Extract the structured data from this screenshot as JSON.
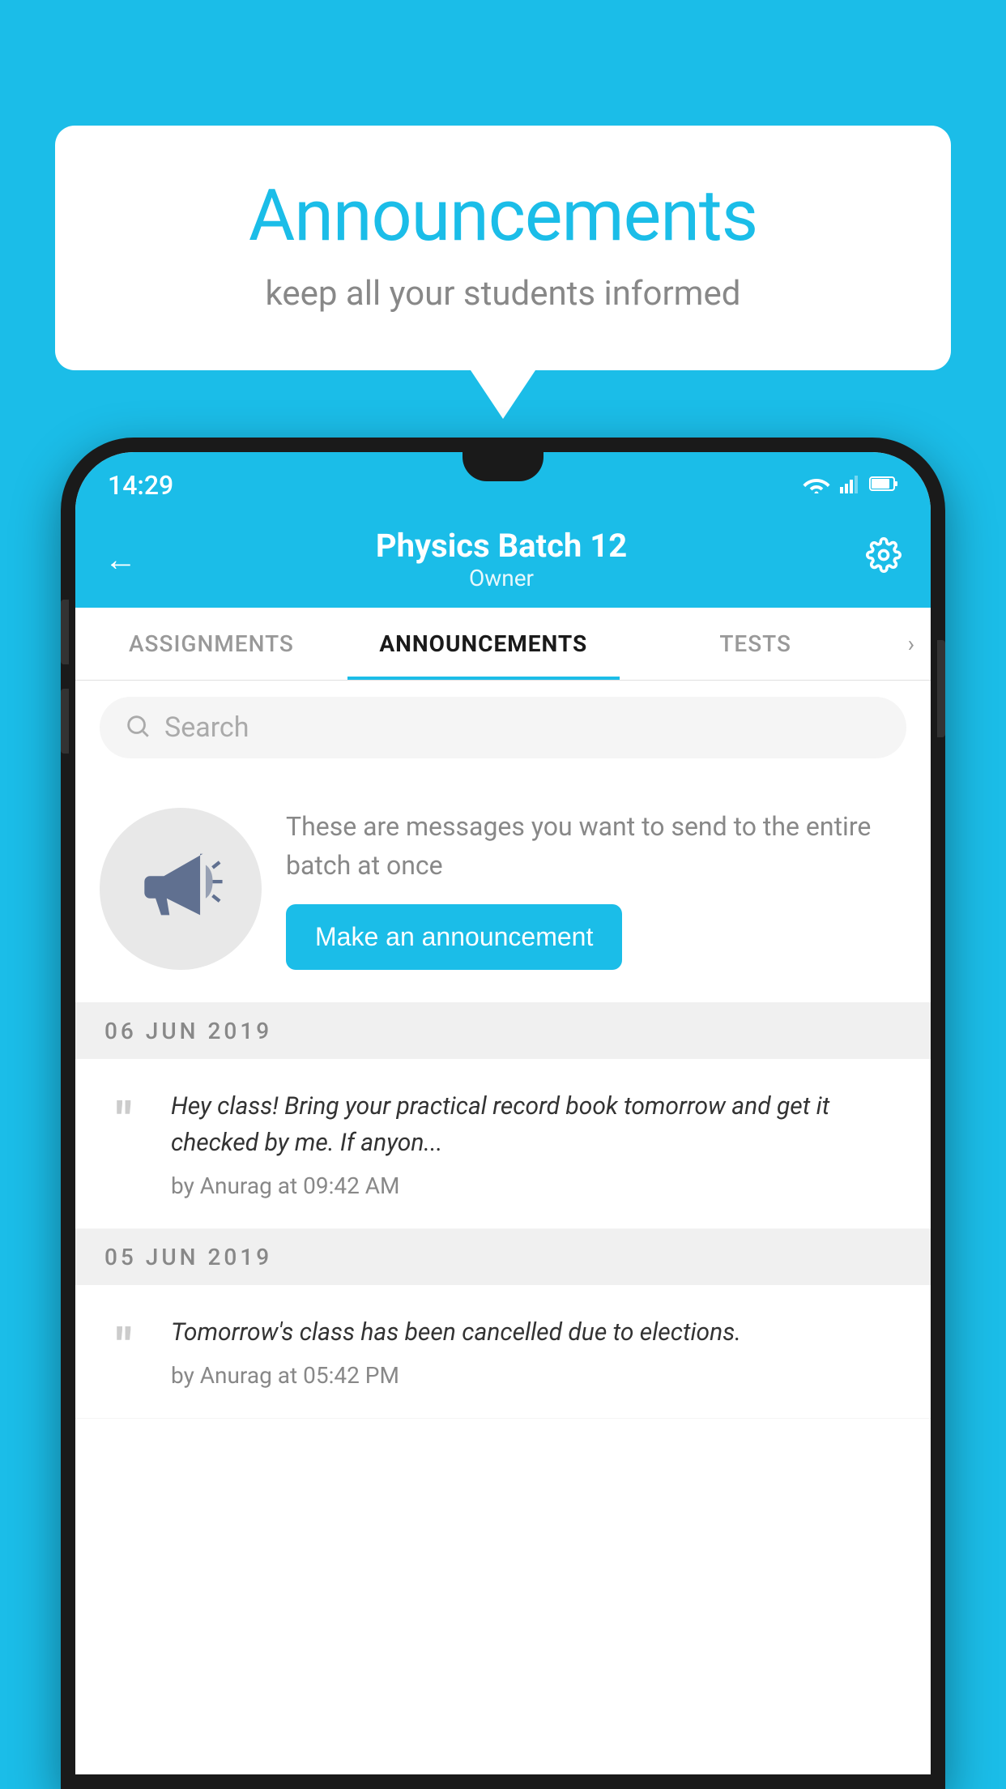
{
  "bubble": {
    "title": "Announcements",
    "subtitle": "keep all your students informed"
  },
  "phone": {
    "statusBar": {
      "time": "14:29",
      "wifiIcon": "▾",
      "signalIcon": "▲",
      "batteryIcon": "▮"
    },
    "header": {
      "title": "Physics Batch 12",
      "subtitle": "Owner",
      "backLabel": "←",
      "settingsLabel": "⚙"
    },
    "tabs": [
      {
        "label": "ASSIGNMENTS",
        "active": false
      },
      {
        "label": "ANNOUNCEMENTS",
        "active": true
      },
      {
        "label": "TESTS",
        "active": false
      }
    ],
    "search": {
      "placeholder": "Search"
    },
    "promo": {
      "description": "These are messages you want to send to the entire batch at once",
      "buttonLabel": "Make an announcement"
    },
    "announcements": [
      {
        "date": "06  JUN  2019",
        "text": "Hey class! Bring your practical record book tomorrow and get it checked by me. If anyon...",
        "meta": "by Anurag at 09:42 AM"
      },
      {
        "date": "05  JUN  2019",
        "text": "Tomorrow's class has been cancelled due to elections.",
        "meta": "by Anurag at 05:42 PM"
      }
    ]
  }
}
